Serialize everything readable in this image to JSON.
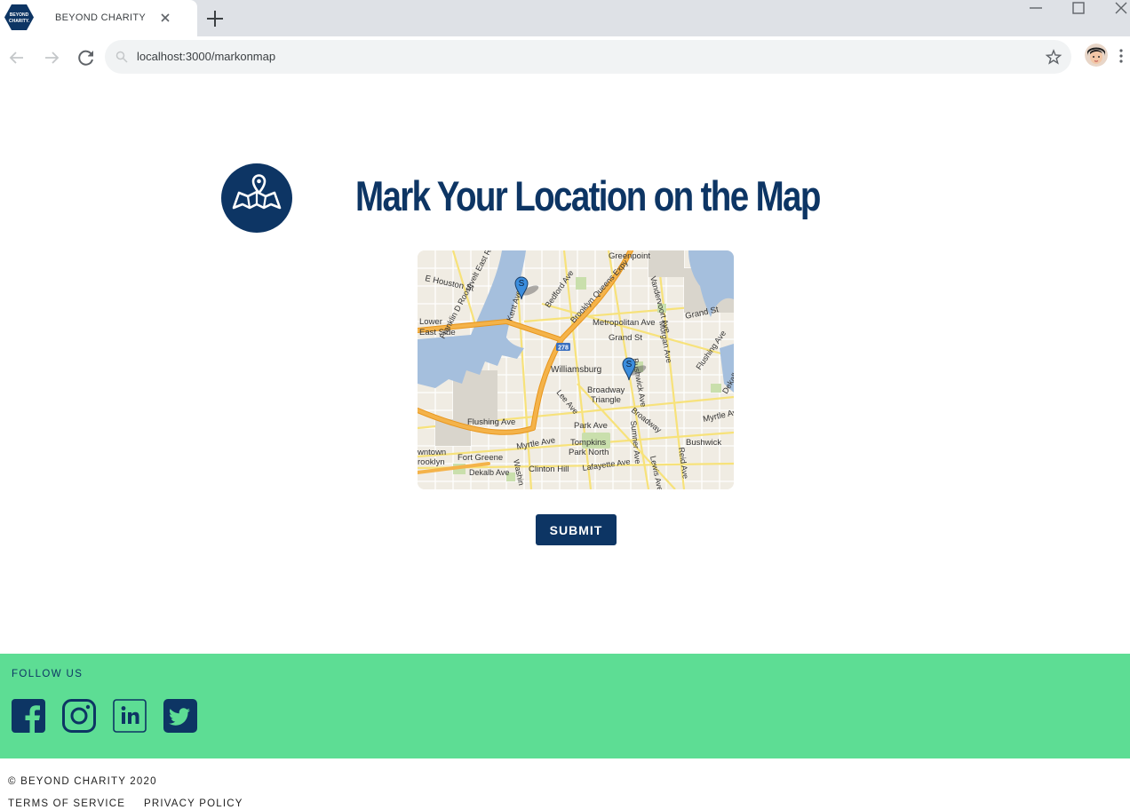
{
  "browser": {
    "tab_title": "BEYOND CHARITY",
    "favicon_text_top": "BEYOND",
    "favicon_text_bottom": "CHARITY.",
    "url": "localhost:3000/markonmap"
  },
  "page": {
    "title": "Mark Your Location on the Map",
    "hero_icon": "map-pin-icon"
  },
  "map": {
    "labels": {
      "greenpoint": "Greenpoint",
      "e_houston": "E Houston St",
      "fdr": "Franklin D Roosevelt East River Dr",
      "kent": "Kent Ave",
      "bedford": "Bedford Ave",
      "bqe": "Brooklyn Queens Expy",
      "vandervoort": "Vandervoort Ave",
      "metropolitan": "Metropolitan Ave",
      "grand_st": "Grand St",
      "grand_st2": "Grand St",
      "lower_east": "Lower",
      "east_side": "East Side",
      "morgan": "Morgan Ave",
      "route": "278",
      "williamsburg": "Williamsburg",
      "broadway_triangle_1": "Broadway",
      "broadway_triangle_2": "Triangle",
      "lee": "Lee Ave",
      "bushwick_ave": "Bushwick Ave",
      "flushing": "Flushing Ave",
      "flushing2": "Flushing Ave",
      "park": "Park Ave",
      "broadway": "Broadway",
      "myrtle": "Myrtle Ave",
      "myrtle2": "Myrtle Ave",
      "tompkins_1": "Tompkins",
      "tompkins_2": "Park North",
      "bushwick": "Bushwick",
      "downtown": "wntown",
      "brooklyn": "rooklyn",
      "fort_greene": "Fort Greene",
      "dekalb": "Dekalb Ave",
      "dekalb2": "Dekalb Ave",
      "clinton_hill": "Clinton Hill",
      "lafayette": "Lafayette Ave",
      "washington": "Washin",
      "sumner": "Sumner Ave",
      "lewis": "Lewis Ave",
      "reid": "Reid Ave"
    },
    "marker_letter": "S",
    "markers": [
      "marker-1",
      "marker-2"
    ]
  },
  "submit_label": "SUBMIT",
  "footer": {
    "follow_label": "FOLLOW US",
    "social": [
      "facebook-icon",
      "instagram-icon",
      "linkedin-icon",
      "twitter-icon"
    ],
    "copyright": "© BEYOND CHARITY 2020",
    "terms": "TERMS OF SERVICE",
    "privacy": "PRIVACY POLICY"
  },
  "colors": {
    "brand_navy": "#0d3564",
    "footer_green": "#5ddd94",
    "map_water": "#a5bfdd",
    "map_highway": "#f4b34a",
    "map_marker": "#3b8ddd"
  }
}
